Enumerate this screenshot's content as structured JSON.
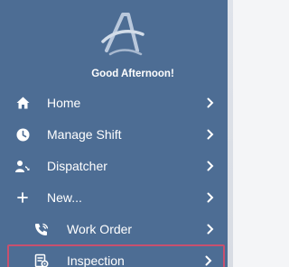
{
  "greeting": "Good Afternoon!",
  "menu": {
    "home": "Home",
    "manage_shift": "Manage Shift",
    "dispatcher": "Dispatcher",
    "new": "New...",
    "work_order": "Work Order",
    "inspection": "Inspection"
  },
  "colors": {
    "drawer_bg": "#4d6d94",
    "text": "#ffffff",
    "selected_border": "#c8506e"
  },
  "icons": {
    "logo": "app-logo-a",
    "home": "home-icon",
    "manage_shift": "clock-icon",
    "dispatcher": "person-phone-icon",
    "new": "plus-icon",
    "work_order": "phone-icon",
    "inspection": "clipboard-gear-icon",
    "chevron": "chevron-right-icon"
  },
  "selected_item": "inspection"
}
